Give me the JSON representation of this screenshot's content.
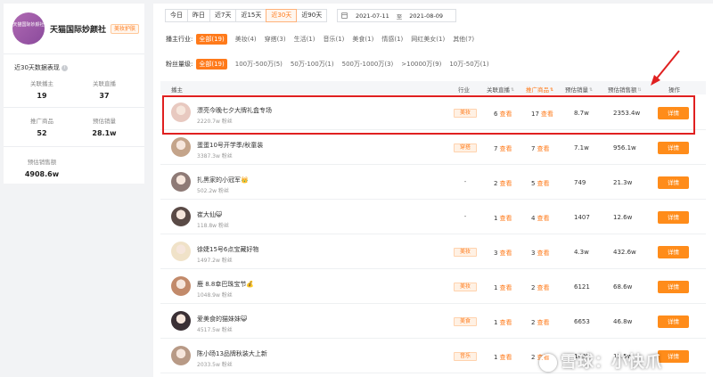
{
  "shop": {
    "logo_text": "天猫国际妙颜社",
    "name": "天猫国际妙颜社",
    "tag": "美妆护肤"
  },
  "summary": {
    "title": "近30天数据表现",
    "info_icon": "info-icon",
    "stats": [
      {
        "label": "关联播主",
        "value": "19"
      },
      {
        "label": "关联直播",
        "value": "37"
      },
      {
        "label": "推广商品",
        "value": "52"
      },
      {
        "label": "预估销量",
        "value": "28.1w"
      },
      {
        "label": "预估销售额",
        "value": "4908.6w"
      }
    ]
  },
  "date_tabs": [
    "今日",
    "昨日",
    "近7天",
    "近15天",
    "近30天",
    "近90天"
  ],
  "date_tabs_active": "近30天",
  "date_range": {
    "start": "2021-07-11",
    "sep": "至",
    "end": "2021-08-09"
  },
  "filters": {
    "industry": {
      "label": "播主行业:",
      "options": [
        "全部(19)",
        "美妆(4)",
        "穿搭(3)",
        "生活(1)",
        "音乐(1)",
        "美食(1)",
        "情感(1)",
        "网红美女(1)",
        "其他(7)"
      ]
    },
    "fans": {
      "label": "粉丝量级:",
      "options": [
        "全部(19)",
        "100万-500万(5)",
        "50万-100万(1)",
        "500万-1000万(3)",
        ">10000万(9)",
        "10万-50万(1)"
      ]
    }
  },
  "table": {
    "headers": {
      "anchor": "播主",
      "industry": "行业",
      "live": "关联直播",
      "products": "推广商品",
      "sales": "预估销量",
      "revenue": "预估销售额",
      "action": "操作"
    },
    "view_label": "查看",
    "detail_label": "详情",
    "rows": [
      {
        "name": "漂亮今晚七夕大牌礼盒专场",
        "fans": "2220.7w 粉丝",
        "industry": "美妆",
        "live": "6",
        "products": "17",
        "sales": "8.7w",
        "revenue": "2353.4w"
      },
      {
        "name": "蛋蛋10号开学季/秋童装",
        "fans": "3387.3w 粉丝",
        "industry": "穿搭",
        "live": "7",
        "products": "7",
        "sales": "7.1w",
        "revenue": "956.1w"
      },
      {
        "name": "扎黑家的小冠军👑",
        "fans": "502.2w 粉丝",
        "industry": "-",
        "live": "2",
        "products": "5",
        "sales": "749",
        "revenue": "21.3w"
      },
      {
        "name": "崔大仙😺",
        "fans": "118.8w 粉丝",
        "industry": "-",
        "live": "1",
        "products": "4",
        "sales": "1407",
        "revenue": "12.6w"
      },
      {
        "name": "徐婕15号6点宝藏好物",
        "fans": "1497.2w 粉丝",
        "industry": "美妆",
        "live": "3",
        "products": "3",
        "sales": "4.3w",
        "revenue": "432.6w"
      },
      {
        "name": "鹿 8.8幸巴珠宝节💰",
        "fans": "1048.9w 粉丝",
        "industry": "美妆",
        "live": "1",
        "products": "2",
        "sales": "6121",
        "revenue": "68.6w"
      },
      {
        "name": "爱美食的猫妹妹😺",
        "fans": "4517.5w 粉丝",
        "industry": "美食",
        "live": "1",
        "products": "2",
        "sales": "6653",
        "revenue": "46.8w"
      },
      {
        "name": "陈小旸13品牌秋装大上新",
        "fans": "2033.5w 粉丝",
        "industry": "音乐",
        "live": "1",
        "products": "2",
        "sales": "1495",
        "revenue": "13.5w"
      }
    ]
  },
  "watermark": "雪球：小快爪",
  "colors": {
    "accent": "#ff7a1a",
    "highlight": "#e02020"
  }
}
